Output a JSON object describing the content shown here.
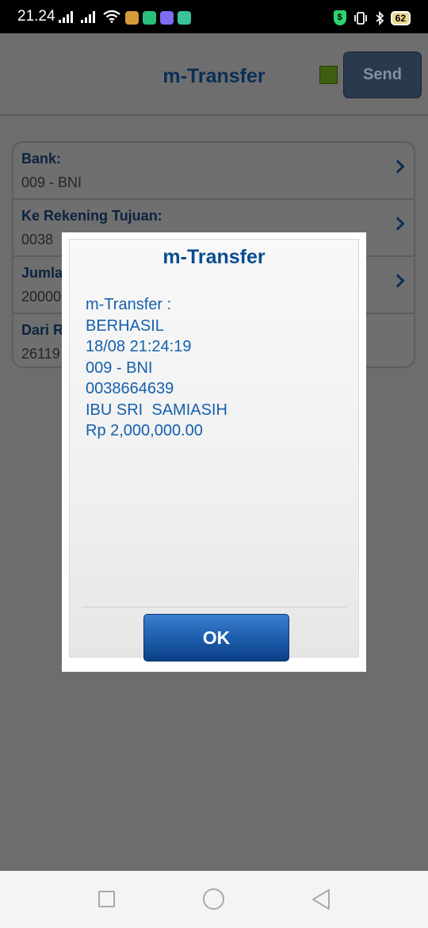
{
  "status_bar": {
    "time": "21.24",
    "battery": "62",
    "vpn_badge": "$"
  },
  "header": {
    "title": "m-Transfer",
    "send_label": "Send"
  },
  "form": {
    "rows": [
      {
        "label": "Bank:",
        "value": "009 - BNI"
      },
      {
        "label": "Ke Rekening Tujuan:",
        "value": "0038"
      },
      {
        "label": "Jumla",
        "value": "20000"
      },
      {
        "label": "Dari R",
        "value": "26119"
      }
    ]
  },
  "dialog": {
    "title": "m-Transfer",
    "lines": [
      "m-Transfer :",
      "BERHASIL",
      "18/08 21:24:19",
      "009 - BNI",
      "0038664639",
      "IBU SRI  SAMIASIH",
      "Rp 2,000,000.00"
    ],
    "ok_label": "OK"
  },
  "colors": {
    "accent": "#0b4d8f",
    "ok_button": "#1d5fae",
    "overlay": "#6d6d6d"
  },
  "icons": [
    "wifi-icon",
    "signal-icon",
    "bluetooth-icon",
    "vibrate-icon",
    "battery-icon",
    "chevron-right-icon",
    "nav-recents-icon",
    "nav-home-icon",
    "nav-back-icon"
  ]
}
